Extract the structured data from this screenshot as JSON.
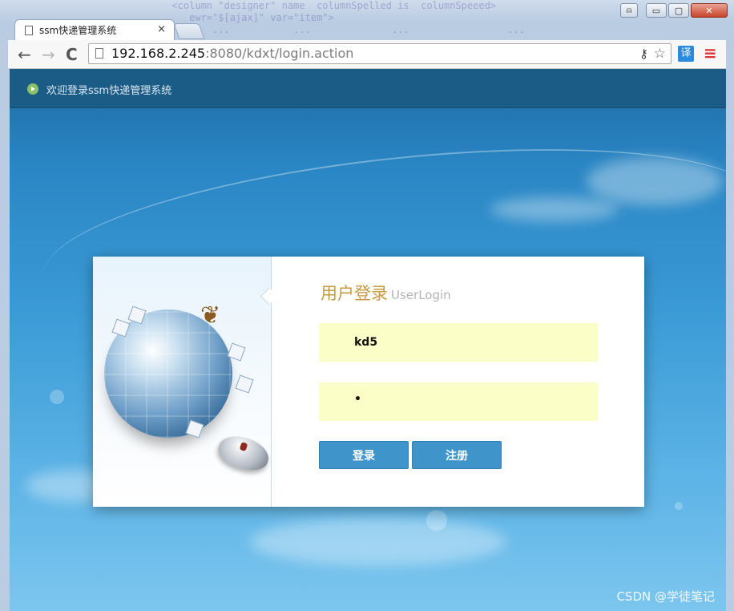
{
  "window": {
    "tab_title": "ssm快递管理系统",
    "tab_close": "×",
    "controls": {
      "minimize": "▭",
      "maximize": "▢",
      "close": "✕",
      "user": "⍝"
    }
  },
  "toolbar": {
    "back": "←",
    "forward": "→",
    "reload": "C",
    "url_host": "192.168.2.245",
    "url_rest": ":8080/kdxt/login.action",
    "translate": "译",
    "menu": "≡"
  },
  "page": {
    "welcome_text": "欢迎登录ssm快递管理系统",
    "login": {
      "title": "用户登录",
      "subtitle": "UserLogin",
      "username_value": "kd5",
      "password_value": "•",
      "login_button": "登录",
      "register_button": "注册"
    },
    "watermark": "CSDN @学徒笔记"
  },
  "colors": {
    "header_bar": "#1b5c86",
    "title_gold": "#c89a3f",
    "input_bg": "#fbfec6",
    "button_blue": "#3f95c9"
  }
}
